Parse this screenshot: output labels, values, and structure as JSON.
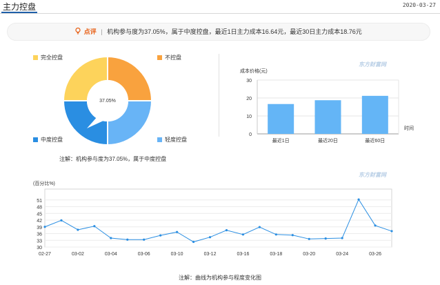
{
  "header": {
    "title": "主力控盘",
    "date": "2020-03-27"
  },
  "comment": {
    "label": "点评",
    "separator": "|",
    "text": "机构参与度为37.05%，属于中度控盘，最近1日主力成本16.64元，最近30日主力成本18.76元"
  },
  "donut": {
    "center_label": "37.05%",
    "note": "注解：机构参与度为37.05%，属于中度控盘",
    "legend": [
      {
        "label": "完全控盘",
        "color": "#fdd35b"
      },
      {
        "label": "不控盘",
        "color": "#f9a23e"
      },
      {
        "label": "中度控盘",
        "color": "#2a8ee2"
      },
      {
        "label": "轻度控盘",
        "color": "#68b4f6"
      }
    ],
    "active": "中度控盘"
  },
  "watermark": "东方财富网",
  "chart_data": [
    {
      "type": "bar",
      "ylabel": "成本价格(元)",
      "xlabel": "时间",
      "categories": [
        "最近1日",
        "最近20日",
        "最近60日"
      ],
      "values": [
        16.64,
        18.76,
        21.2
      ],
      "ylim": [
        0,
        30
      ],
      "yticks": [
        0,
        10,
        20,
        30
      ],
      "color": "#64b5f6",
      "grid": true
    },
    {
      "type": "line",
      "ylabel": "(百分比%)",
      "note": "注解：曲线为机构参与程度变化图",
      "x": [
        "02-27",
        "02-28",
        "03-02",
        "03-03",
        "03-04",
        "03-05",
        "03-06",
        "03-09",
        "03-10",
        "03-11",
        "03-12",
        "03-13",
        "03-16",
        "03-17",
        "03-18",
        "03-19",
        "03-20",
        "03-23",
        "03-24",
        "03-25",
        "03-26",
        "03-27"
      ],
      "xtick_labels": [
        "02-27",
        "03-02",
        "03-04",
        "03-06",
        "03-10",
        "03-12",
        "03-16",
        "03-18",
        "03-20",
        "03-24",
        "03-26"
      ],
      "values": [
        39.0,
        41.9,
        37.7,
        39.3,
        34.0,
        33.3,
        33.3,
        35.2,
        36.7,
        32.3,
        34.4,
        37.5,
        35.6,
        38.9,
        35.6,
        35.3,
        33.6,
        33.8,
        34.0,
        51.2,
        39.6,
        37.1
      ],
      "ylim": [
        30,
        54
      ],
      "yticks": [
        30,
        33,
        36,
        39,
        42,
        45,
        48,
        51
      ],
      "color": "#2a8ee2",
      "grid": true
    }
  ]
}
